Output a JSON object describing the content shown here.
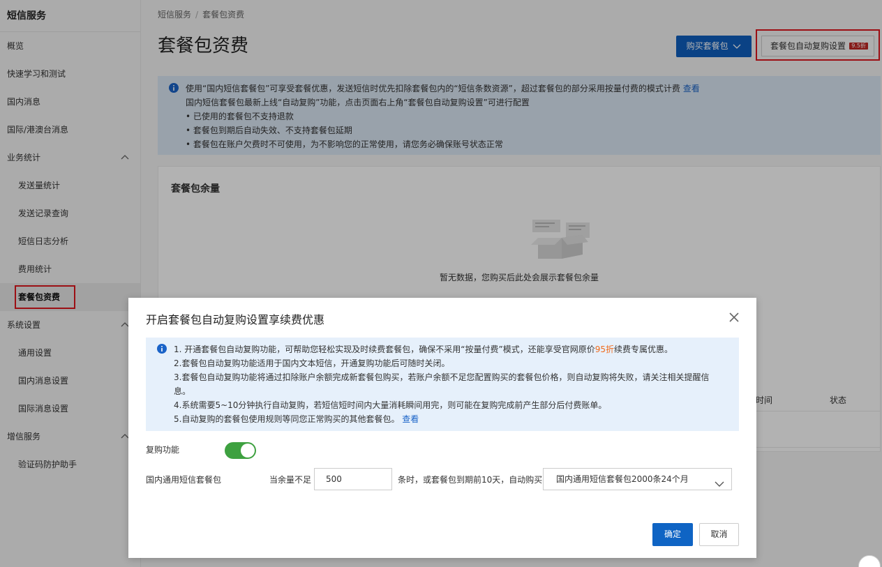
{
  "sidebar": {
    "brand": "短信服务",
    "items": [
      {
        "label": "概览"
      },
      {
        "label": "快速学习和测试"
      },
      {
        "label": "国内消息"
      },
      {
        "label": "国际/港澳台消息"
      },
      {
        "label": "业务统计"
      },
      {
        "label": "发送量统计"
      },
      {
        "label": "发送记录查询"
      },
      {
        "label": "短信日志分析"
      },
      {
        "label": "费用统计"
      },
      {
        "label": "套餐包资费"
      },
      {
        "label": "系统设置"
      },
      {
        "label": "通用设置"
      },
      {
        "label": "国内消息设置"
      },
      {
        "label": "国际消息设置"
      },
      {
        "label": "增信服务"
      },
      {
        "label": "验证码防护助手"
      }
    ]
  },
  "breadcrumb": {
    "root": "短信服务",
    "sep": "/",
    "current": "套餐包资费"
  },
  "page_title": "套餐包资费",
  "header_buttons": {
    "buy": "购买套餐包",
    "auto_setting": "套餐包自动复购设置",
    "auto_badge": "9.5折"
  },
  "notice": {
    "line1": "使用“国内短信套餐包”可享受套餐优惠，发送短信时优先扣除套餐包内的“短信条数资源”，超过套餐包的部分采用按量付费的模式计费",
    "line1_link": "查看",
    "line2": "国内短信套餐包最新上线“自动复购”功能，点击页面右上角“套餐包自动复购设置”可进行配置",
    "bullets": [
      "• 已使用的套餐包不支持退款",
      "• 套餐包到期后自动失效、不支持套餐包延期",
      "• 套餐包在账户欠费时不可使用，为不影响您的正常使用，请您务必确保账号状态正常"
    ]
  },
  "card": {
    "title": "套餐包余量",
    "empty_text": "暂无数据，您购买后此处会展示套餐包余量",
    "col_time": "时间",
    "col_status": "状态"
  },
  "modal": {
    "title": "开启套餐包自动复购设置享续费优惠",
    "notice": {
      "l1_pre": "1. 开通套餐包自动复购功能，可帮助您轻松实现及时续费套餐包，确保不采用“按量付费”模式，还能享受官网原价",
      "l1_hl": "95折",
      "l1_post": "续费专属优惠。",
      "l2": "2.套餐包自动复购功能适用于国内文本短信，开通复购功能后可随时关闭。",
      "l3a": "3.套餐包自动复购功能将通过扣除账户余额完成新套餐包购买，若账户余额不足您配置购买的套餐包价格，则自动复购将失败，请关注相关提醒信",
      "l3b": "息。",
      "l4": "4.系统需要5~10分钟执行自动复购，若短信短时间内大量消耗瞬间用完，则可能在复购完成前产生部分后付费账单。",
      "l5": "5.自动复购的套餐包使用规则等同您正常购买的其他套餐包。",
      "l5_link": "查看"
    },
    "toggle_label": "复购功能",
    "toggle_on": true,
    "package_label": "国内通用短信套餐包",
    "threshold_prefix": "当余量不足",
    "threshold_value": "500",
    "threshold_suffix": "条时，或套餐包到期前10天，自动购买",
    "package_select": "国内通用短信套餐包2000条24个月",
    "ok": "确定",
    "cancel": "取消"
  }
}
